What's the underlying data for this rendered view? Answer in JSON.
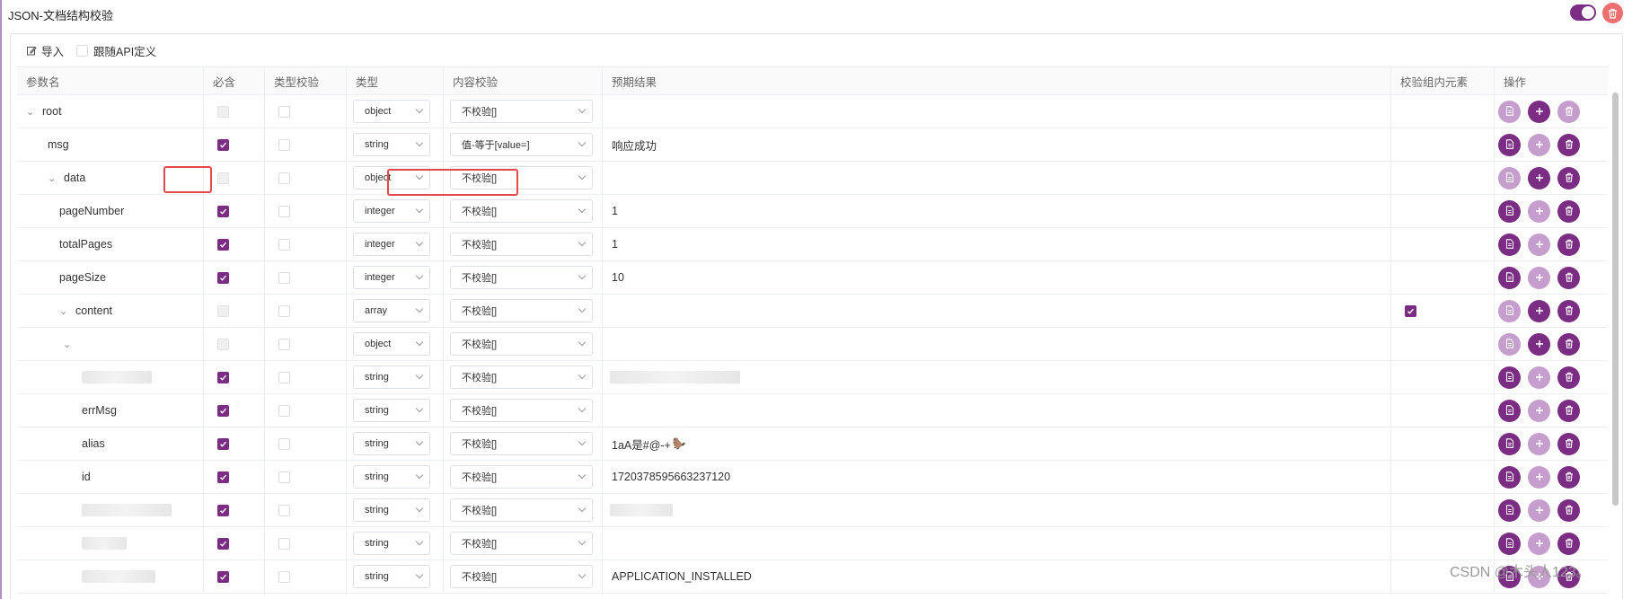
{
  "panel": {
    "title": "JSON-文档结构校验",
    "toolbar": {
      "import_label": "导入",
      "follow_label": "跟随API定义"
    }
  },
  "columns": [
    "参数名",
    "必含",
    "类型校验",
    "类型",
    "内容校验",
    "预期结果",
    "校验组内元素",
    "操作"
  ],
  "rows": [
    {
      "name": "root",
      "indent": 0,
      "chevron": true,
      "blurred": false,
      "required": "disabled",
      "type": "object",
      "content_check": "不校验[]",
      "expected": "",
      "group": false,
      "ops": [
        "light",
        "dark",
        "light"
      ]
    },
    {
      "name": "msg",
      "indent": 1,
      "chevron": false,
      "blurred": false,
      "required": "on",
      "type": "string",
      "content_check": "值-等于[value=]",
      "expected": "响应成功",
      "group": false,
      "ops": [
        "dark",
        "light",
        "dark"
      ]
    },
    {
      "name": "data",
      "indent": 1,
      "chevron": true,
      "blurred": false,
      "required": "disabled",
      "type": "object",
      "content_check": "不校验[]",
      "expected": "",
      "group": false,
      "ops": [
        "light",
        "dark",
        "dark"
      ]
    },
    {
      "name": "pageNumber",
      "indent": 2,
      "chevron": false,
      "blurred": false,
      "required": "on",
      "type": "integer",
      "content_check": "不校验[]",
      "expected": "1",
      "group": false,
      "ops": [
        "dark",
        "light",
        "dark"
      ]
    },
    {
      "name": "totalPages",
      "indent": 2,
      "chevron": false,
      "blurred": false,
      "required": "on",
      "type": "integer",
      "content_check": "不校验[]",
      "expected": "1",
      "group": false,
      "ops": [
        "dark",
        "light",
        "dark"
      ]
    },
    {
      "name": "pageSize",
      "indent": 2,
      "chevron": false,
      "blurred": false,
      "required": "on",
      "type": "integer",
      "content_check": "不校验[]",
      "expected": "10",
      "group": false,
      "ops": [
        "dark",
        "light",
        "dark"
      ]
    },
    {
      "name": "content",
      "indent": 2,
      "chevron": true,
      "blurred": false,
      "required": "disabled",
      "type": "array",
      "content_check": "不校验[]",
      "expected": "",
      "group": true,
      "ops": [
        "light",
        "dark",
        "dark"
      ]
    },
    {
      "name": "",
      "indent": 3,
      "chevron": true,
      "blurred": false,
      "required": "disabled",
      "type": "object",
      "content_check": "不校验[]",
      "expected": "",
      "group": false,
      "ops": [
        "light",
        "dark",
        "dark"
      ]
    },
    {
      "name": "",
      "indent": 4,
      "chevron": false,
      "blurred": true,
      "required": "on",
      "type": "string",
      "content_check": "不校验[]",
      "expected": "",
      "expected_blurred": true,
      "group": false,
      "ops": [
        "dark",
        "light",
        "dark"
      ]
    },
    {
      "name": "errMsg",
      "indent": 4,
      "chevron": false,
      "blurred": false,
      "required": "on",
      "type": "string",
      "content_check": "不校验[]",
      "expected": "",
      "group": false,
      "ops": [
        "dark",
        "light",
        "dark"
      ]
    },
    {
      "name": "alias",
      "indent": 4,
      "chevron": false,
      "blurred": false,
      "required": "on",
      "type": "string",
      "content_check": "不校验[]",
      "expected": "1aA是#@-+",
      "expected_icon": true,
      "group": false,
      "ops": [
        "dark",
        "light",
        "dark"
      ]
    },
    {
      "name": "id",
      "indent": 4,
      "chevron": false,
      "blurred": false,
      "required": "on",
      "type": "string",
      "content_check": "不校验[]",
      "expected": "1720378595663237120",
      "group": false,
      "ops": [
        "dark",
        "light",
        "dark"
      ]
    },
    {
      "name": "",
      "indent": 4,
      "chevron": false,
      "blurred": true,
      "required": "on",
      "type": "string",
      "content_check": "不校验[]",
      "expected": "",
      "expected_blurred": true,
      "group": false,
      "ops": [
        "dark",
        "light",
        "dark"
      ]
    },
    {
      "name": "",
      "indent": 4,
      "chevron": false,
      "blurred": true,
      "required": "on",
      "type": "string",
      "content_check": "不校验[]",
      "expected": "",
      "group": false,
      "ops": [
        "dark",
        "light",
        "dark"
      ]
    },
    {
      "name": "",
      "indent": 4,
      "chevron": false,
      "blurred": true,
      "required": "on",
      "type": "string",
      "content_check": "不校验[]",
      "expected": "APPLICATION_INSTALLED",
      "group": false,
      "ops": [
        "dark",
        "light",
        "dark"
      ]
    }
  ],
  "op_icons": [
    "doc-icon",
    "plus-icon",
    "trash-icon"
  ],
  "colors": {
    "accent": "#7b2d84",
    "accent_light": "#c69ecd",
    "danger": "#ee6f6f",
    "highlight": "#e2484c"
  },
  "watermark": "CSDN @木头人123。"
}
